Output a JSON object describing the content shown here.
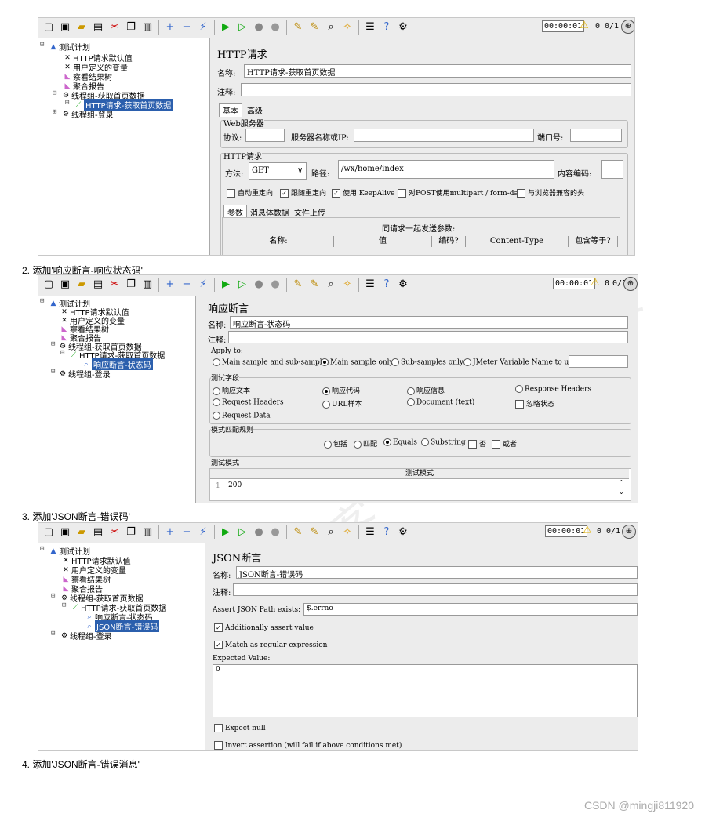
{
  "steps": {
    "s2": "2.  添加'响应断言-响应状态码'",
    "s3": "3.  添加'JSON断言-错误码'",
    "s4": "4.  添加'JSON断言-错误消息'"
  },
  "footer": "CSDN @mingji811920",
  "toolbar": {
    "timer": "00:00:01",
    "warn_count": "0",
    "thread_count": "0/1"
  },
  "shot1": {
    "tree": [
      "测试计划",
      "HTTP请求默认值",
      "用户定义的变量",
      "察看结果树",
      "聚合报告",
      "线程组-获取首页数据",
      "HTTP请求-获取首页数据",
      "线程组-登录"
    ],
    "title": "HTTP请求",
    "name_label": "名称:",
    "name_value": "HTTP请求-获取首页数据",
    "comment_label": "注释:",
    "tab_basic": "基本",
    "tab_adv": "高级",
    "web_server": "Web服务器",
    "protocol": "协议:",
    "server": "服务器名称或IP:",
    "port": "端口号:",
    "http_req": "HTTP请求",
    "method": "方法:",
    "method_value": "GET",
    "path": "路径:",
    "path_value": "/wx/home/index",
    "encoding": "内容编码:",
    "opt1": "自动重定向",
    "opt2": "跟随重定向",
    "opt3": "使用 KeepAlive",
    "opt4": "对POST使用multipart / form-data",
    "opt5": "与浏览器兼容的头",
    "subtab1": "参数",
    "subtab2": "消息体数据",
    "subtab3": "文件上传",
    "params_title": "同请求一起发送参数:",
    "cols": [
      "名称:",
      "值",
      "编码?",
      "Content-Type",
      "包含等于?"
    ]
  },
  "shot2": {
    "tree": [
      "测试计划",
      "HTTP请求默认值",
      "用户定义的变量",
      "察看结果树",
      "聚合报告",
      "线程组-获取首页数据",
      "HTTP请求-获取首页数据",
      "响应断言-状态码",
      "线程组-登录"
    ],
    "title": "响应断言",
    "name_label": "名称:",
    "name_value": "响应断言-状态码",
    "comment_label": "注释:",
    "apply_to": "Apply to:",
    "apply": [
      "Main sample and sub-samples",
      "Main sample only",
      "Sub-samples only",
      "JMeter Variable Name to use"
    ],
    "field_title": "测试字段",
    "fields": [
      "响应文本",
      "响应代码",
      "响应信息",
      "Response Headers",
      "Request Headers",
      "URL样本",
      "Document (text)",
      "忽略状态",
      "Request Data"
    ],
    "rule_title": "模式匹配规则",
    "rules": [
      "包括",
      "匹配",
      "Equals",
      "Substring",
      "否",
      "或者"
    ],
    "pattern_title": "测试模式",
    "pattern_header": "测试模式",
    "line_no": "1",
    "pattern_value": "200"
  },
  "shot3": {
    "tree": [
      "测试计划",
      "HTTP请求默认值",
      "用户定义的变量",
      "察看结果树",
      "聚合报告",
      "线程组-获取首页数据",
      "HTTP请求-获取首页数据",
      "响应断言-状态码",
      "JSON断言-错误码",
      "线程组-登录"
    ],
    "title": "JSON断言",
    "name_label": "名称:",
    "name_value": "JSON断言-错误码",
    "comment_label": "注释:",
    "path_label": "Assert JSON Path exists:",
    "path_value": "$.errno",
    "add_assert": "Additionally assert value",
    "regex": "Match as regular expression",
    "expected_label": "Expected Value:",
    "expected_value": "0",
    "expect_null": "Expect null",
    "invert": "Invert assertion (will fail if above conditions met)"
  }
}
